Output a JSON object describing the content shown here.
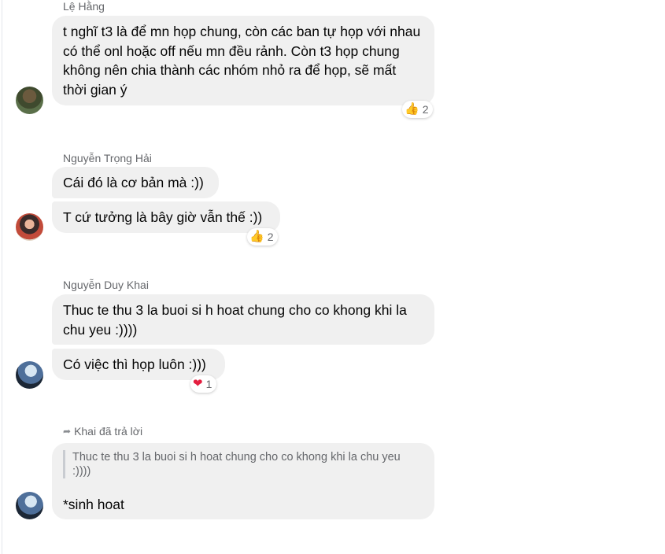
{
  "messages": [
    {
      "sender": "Lệ Hằng",
      "bubbles": [
        "t nghĩ t3 là để mn họp chung, còn các ban tự họp với nhau có thể onl hoặc off nếu mn đều rảnh. Còn t3 họp chung không nên chia thành các nhóm nhỏ ra để họp, sẽ mất thời gian ý"
      ],
      "reaction": {
        "emoji": "thumbs-up",
        "count": "2"
      }
    },
    {
      "sender": "Nguyễn Trọng Hải",
      "bubbles": [
        "Cái đó là cơ bản mà :))",
        "T cứ tưởng là bây giờ vẫn thế :))"
      ],
      "reaction": {
        "emoji": "thumbs-up",
        "count": "2"
      }
    },
    {
      "sender": "Nguyễn Duy Khai",
      "bubbles": [
        "Thuc te thu 3 la buoi si h hoat chung cho co khong khi la chu yeu :))))",
        "Có việc thì họp luôn :)))"
      ],
      "reaction": {
        "emoji": "red-heart",
        "count": "1"
      }
    }
  ],
  "reply": {
    "header": "Khai đã trả lời",
    "quoted_text": "Thuc te thu 3 la buoi si h hoat chung cho co khong khi la chu yeu :))))",
    "text": "*sinh hoat"
  },
  "colors": {
    "bubble": "#f0f0f0",
    "meta_text": "#65676b",
    "heart": "#e41e3f",
    "thumb": "#f7b928"
  }
}
